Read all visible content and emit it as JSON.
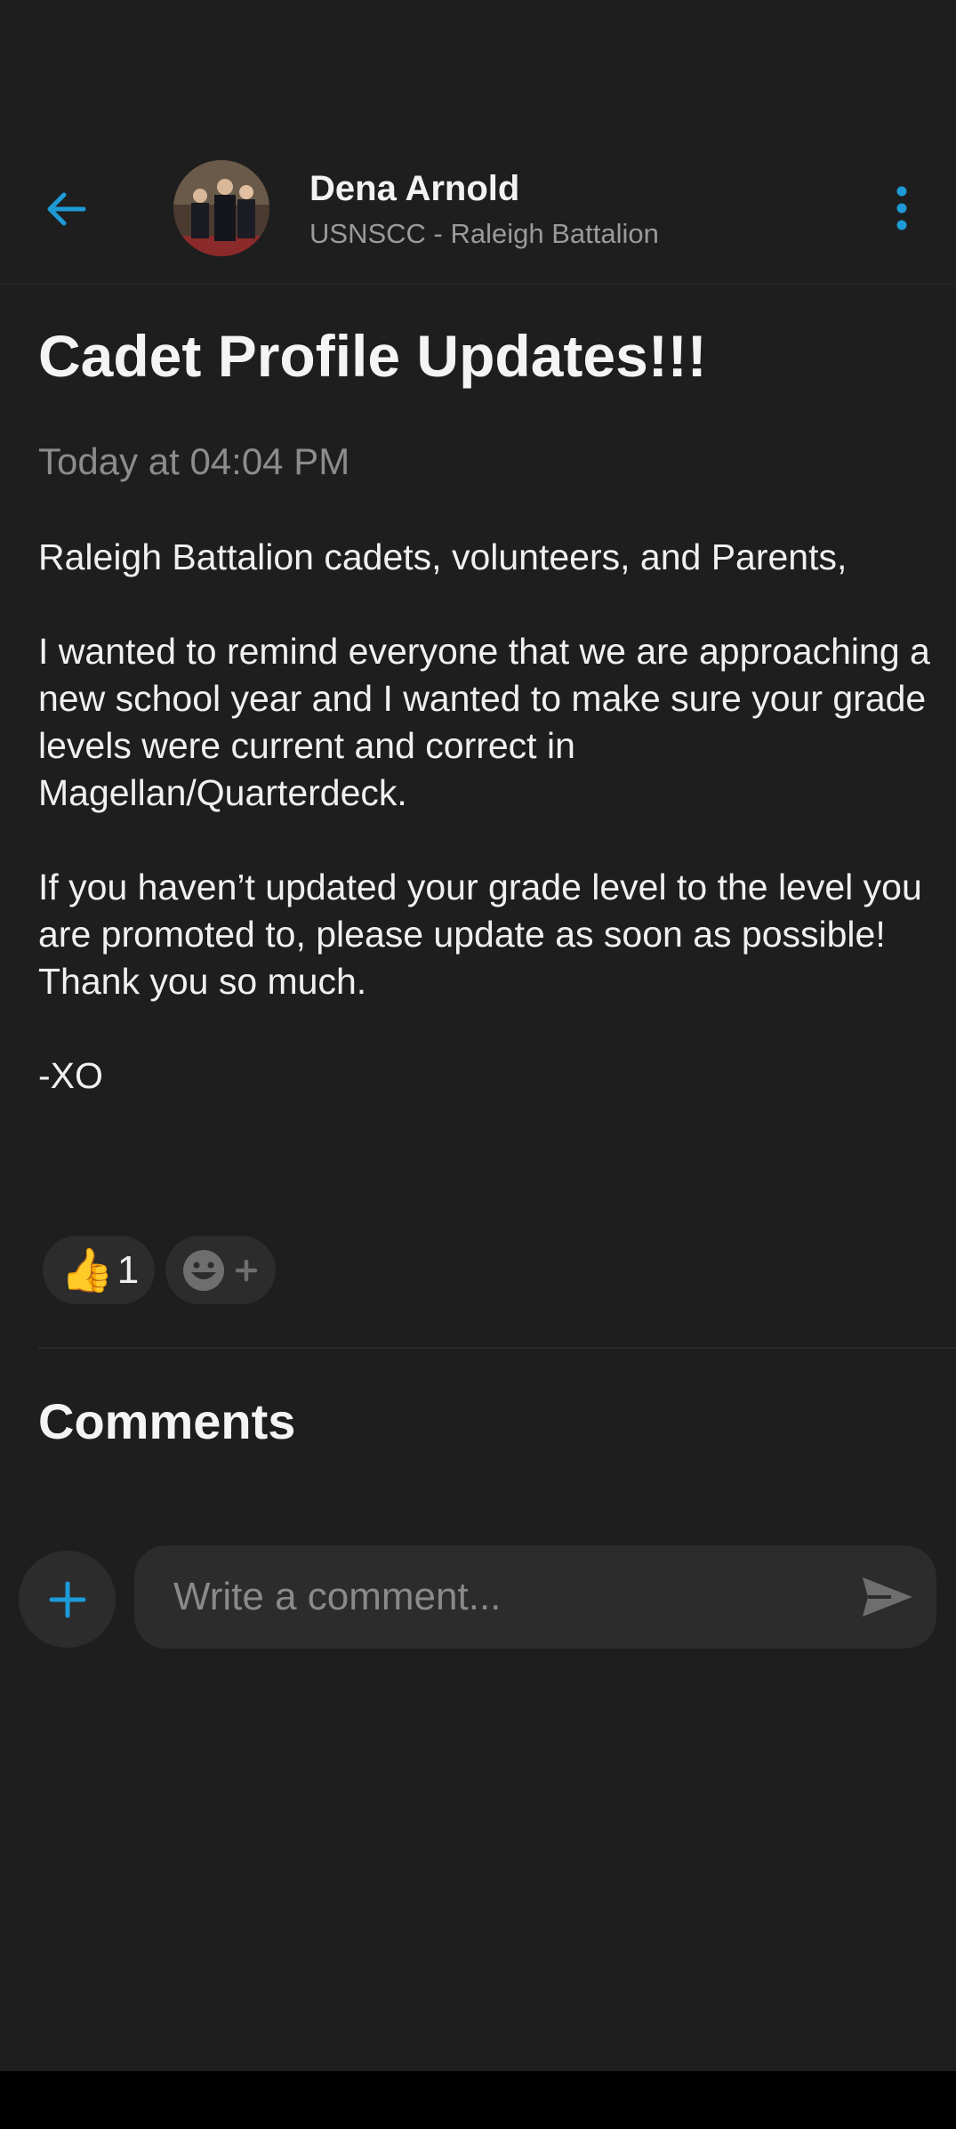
{
  "header": {
    "author_name": "Dena Arnold",
    "author_subtitle": "USNSCC - Raleigh Battalion",
    "back_icon": "arrow-left-icon",
    "more_icon": "more-vertical-icon"
  },
  "post": {
    "title": "Cadet Profile Updates!!!",
    "timestamp": "Today at 04:04 PM",
    "greeting": "Raleigh Battalion cadets, volunteers, and Parents,",
    "paragraph_1": "I wanted to remind everyone that we are approaching a new school year and I wanted to make sure your grade levels were current and correct in Magellan/Quarterdeck.",
    "paragraph_2": "If you haven’t updated your grade level to the level you are promoted to, please update as soon as possible!",
    "thanks": "Thank you so much.",
    "signature": "-XO"
  },
  "reactions": {
    "items": [
      {
        "emoji": "👍",
        "icon": "thumbs-up-icon",
        "count": "1"
      }
    ],
    "add_icon": "smiley-add-icon"
  },
  "comments": {
    "title": "Comments",
    "input_placeholder": "Write a comment...",
    "attach_icon": "plus-icon",
    "send_icon": "send-icon"
  },
  "colors": {
    "accent": "#1e9bd7",
    "background": "#1e1e1e",
    "surface": "#2c2c2c",
    "muted_text": "#8c8c8c"
  }
}
